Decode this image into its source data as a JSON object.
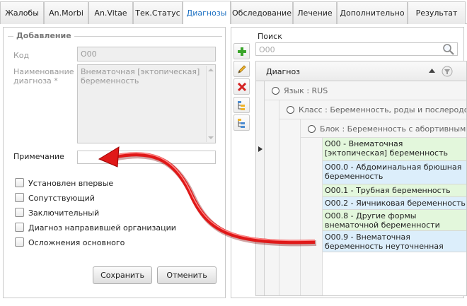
{
  "tabs": [
    {
      "label": "Жалобы",
      "active": false
    },
    {
      "label": "An.Morbi",
      "active": false
    },
    {
      "label": "An.Vitae",
      "active": false
    },
    {
      "label": "Тек.Статус",
      "active": false
    },
    {
      "label": "Диагнозы",
      "active": true
    },
    {
      "label": "Обследование",
      "active": false
    },
    {
      "label": "Лечение",
      "active": false
    },
    {
      "label": "Дополнительно",
      "active": false
    },
    {
      "label": "Результат",
      "active": false
    }
  ],
  "add_group": {
    "title": "Добавление",
    "code_label": "Код",
    "code_value": "O00",
    "name_label": "Наименование диагноза *",
    "name_value": "Внематочная [эктопическая] беременность",
    "note_label": "Примечание",
    "note_value": ""
  },
  "checkboxes": [
    {
      "label": "Установлен впервые",
      "checked": false
    },
    {
      "label": "Сопутствующий",
      "checked": false
    },
    {
      "label": "Заключительный",
      "checked": false
    },
    {
      "label": "Диагноз направившей организации",
      "checked": false
    },
    {
      "label": "Осложнения основного",
      "checked": false
    }
  ],
  "buttons": {
    "save": "Сохранить",
    "cancel": "Отменить"
  },
  "search": {
    "label": "Поиск",
    "placeholder": "O00"
  },
  "toolbar_icons": [
    "add-icon",
    "edit-icon",
    "delete-icon",
    "expand-tree-icon",
    "collapse-tree-icon"
  ],
  "grid": {
    "column": "Диагноз",
    "groups": [
      "Язык : RUS",
      "Класс : Беременность, роды и послеродов",
      "Блок : Беременность с абортивным ис"
    ],
    "rows": [
      {
        "text": "O00 - Внематочная [эктопическая] беременность",
        "color": "#e3f7dc"
      },
      {
        "text": "O00.0 - Абдоминальная  брюшная беременность",
        "color": "#dceefb"
      },
      {
        "text": "O00.1 - Трубная беременность",
        "color": "#e3f7dc"
      },
      {
        "text": "O00.2 - Яичниковая беременность",
        "color": "#dceefb"
      },
      {
        "text": "O00.8 - Другие формы внематочной беременности",
        "color": "#e3f7dc"
      },
      {
        "text": "O00.9 - Внематочная беременность неуточненная",
        "color": "#dceefb"
      }
    ]
  },
  "colors": {
    "active_tab": "#1a6fc2",
    "arrow": "#e01818"
  }
}
